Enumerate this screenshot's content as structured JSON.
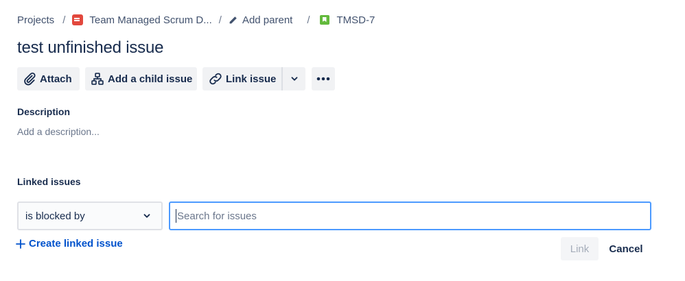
{
  "breadcrumb": {
    "projects": "Projects",
    "separator": "/",
    "project_name": "Team Managed Scrum D...",
    "add_parent": "Add parent",
    "issue_key": "TMSD-7"
  },
  "issue": {
    "title": "test unfinished issue"
  },
  "toolbar": {
    "attach": "Attach",
    "add_child": "Add a child issue",
    "link_issue": "Link issue"
  },
  "description": {
    "label": "Description",
    "placeholder": "Add a description..."
  },
  "linked_issues": {
    "label": "Linked issues",
    "relation_selected": "is blocked by",
    "search_placeholder": "Search for issues",
    "create_link_label": "Create linked issue",
    "link_button": "Link",
    "cancel_button": "Cancel"
  },
  "colors": {
    "text": "#172b4d",
    "subtle_text": "#6b778c",
    "link_blue": "#0052cc",
    "focus_blue": "#4c9aff",
    "button_bg": "#f1f2f4",
    "project_icon": "#e2483d",
    "story_icon": "#63ba3c"
  },
  "icons": [
    "project-avatar-icon",
    "pencil-icon",
    "story-icon",
    "paperclip-icon",
    "child-issue-icon",
    "link-icon",
    "chevron-down-icon",
    "more-icon",
    "plus-icon"
  ]
}
